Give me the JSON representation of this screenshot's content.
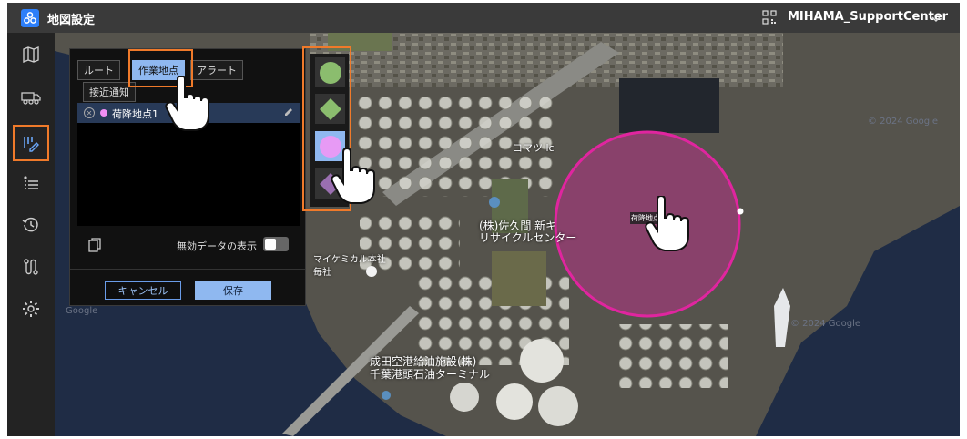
{
  "header": {
    "title": "地図設定",
    "organization": "MIHAMA_SupportCenter"
  },
  "sidebar": {
    "items": [
      {
        "icon": "map-icon"
      },
      {
        "icon": "truck-icon"
      },
      {
        "icon": "edit-list-icon",
        "active": true
      },
      {
        "icon": "list-icon"
      },
      {
        "icon": "history-icon"
      },
      {
        "icon": "route-icon"
      },
      {
        "icon": "gear-icon"
      }
    ]
  },
  "panel": {
    "tabs": [
      "ルート",
      "作業地点",
      "アラート",
      "接近通知"
    ],
    "active_tab": "作業地点",
    "list_items": [
      {
        "label": "荷降地点1",
        "color": "#f08ef5"
      }
    ],
    "toggle_label": "無効データの表示",
    "cancel_label": "キャンセル",
    "save_label": "保存"
  },
  "shape_picker": {
    "options": [
      {
        "shape": "circle",
        "color": "#8bbd6e"
      },
      {
        "shape": "diamond",
        "color": "#8bbd6e"
      },
      {
        "shape": "circle",
        "color": "#e79af5",
        "selected": true
      },
      {
        "shape": "diamond",
        "color": "#9a6fb0"
      }
    ]
  },
  "map": {
    "labels": {
      "komatsu": "コマツ lc",
      "sakuma": "(株)佐久間 新キ",
      "recycle": "リサイクルセンター",
      "chemical": "マイケミカル本社",
      "chemical2": "毎社",
      "narita": "成田空港給油施設(株)",
      "chiba": "千葉港頭石油ターミナル",
      "marker_label": "荷降地点"
    },
    "watermarks": [
      "© 2024 Google",
      "© 2024 Google",
      "Google"
    ],
    "geofence_color": "#e0259f"
  },
  "colors": {
    "accent": "#2d7ff9",
    "highlight": "#f07a2a",
    "save": "#8fb8f0"
  }
}
